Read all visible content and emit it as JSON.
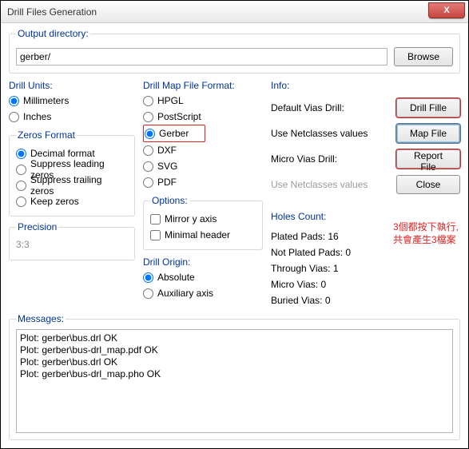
{
  "titlebar": {
    "title": "Drill Files Generation",
    "close": "X"
  },
  "output": {
    "label": "Output directory:",
    "value": "gerber/",
    "browse": "Browse"
  },
  "drillUnits": {
    "title": "Drill Units:",
    "options": [
      "Millimeters",
      "Inches"
    ],
    "selected": 0
  },
  "zerosFormat": {
    "title": "Zeros Format",
    "options": [
      "Decimal format",
      "Suppress leading zeros",
      "Suppress trailing zeros",
      "Keep zeros"
    ],
    "selected": 0
  },
  "precision": {
    "title": "Precision",
    "value": "3:3"
  },
  "drillMap": {
    "title": "Drill Map File Format:",
    "options": [
      "HPGL",
      "PostScript",
      "Gerber",
      "DXF",
      "SVG",
      "PDF"
    ],
    "selected": 2
  },
  "options": {
    "title": "Options:",
    "items": [
      "Mirror y axis",
      "Minimal header"
    ]
  },
  "drillOrigin": {
    "title": "Drill Origin:",
    "options": [
      "Absolute",
      "Auxiliary axis"
    ],
    "selected": 0
  },
  "info": {
    "title": "Info:",
    "rows": [
      {
        "label": "Default Vias Drill:",
        "btn": "Drill Fille"
      },
      {
        "label": "Use Netclasses values",
        "btn": "Map File"
      },
      {
        "label": "Micro Vias Drill:",
        "btn": "Report File"
      },
      {
        "label": "Use Netclasses values",
        "btn": "Close"
      }
    ]
  },
  "holes": {
    "title": "Holes Count:",
    "items": [
      "Plated Pads: 16",
      "Not Plated Pads: 0",
      "Through Vias: 1",
      "Micro Vias: 0",
      "Buried Vias: 0"
    ]
  },
  "annotation": {
    "line1": "3個都按下執行,",
    "line2": "共會產生3檔案"
  },
  "messages": {
    "title": "Messages:",
    "lines": [
      "Plot: gerber\\bus.drl OK",
      "Plot: gerber\\bus-drl_map.pdf OK",
      "Plot: gerber\\bus.drl OK",
      "Plot: gerber\\bus-drl_map.pho OK"
    ]
  }
}
